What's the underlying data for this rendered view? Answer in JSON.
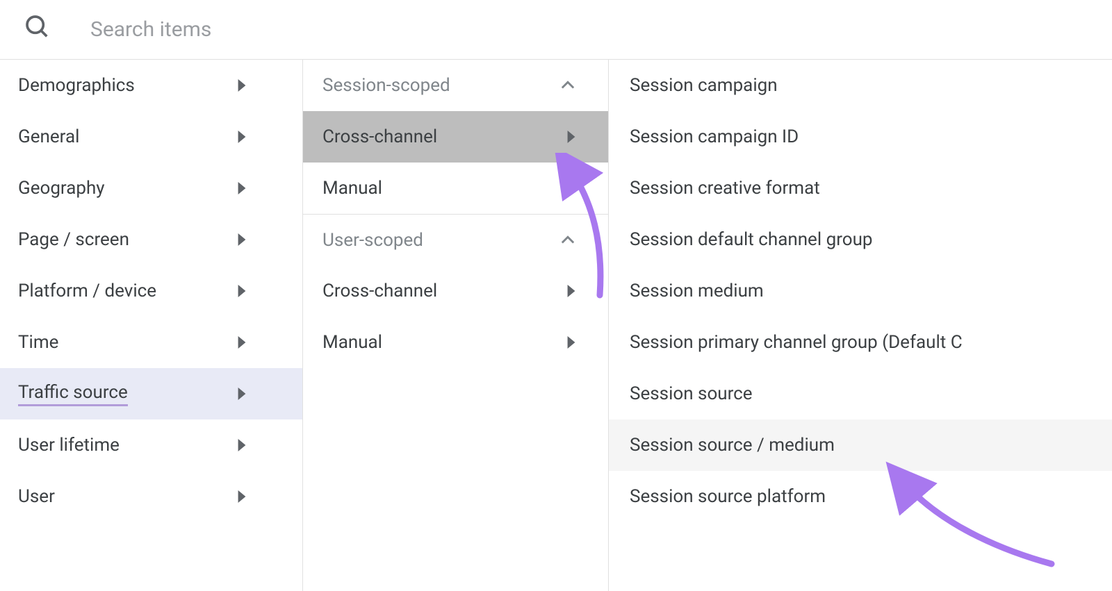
{
  "search": {
    "placeholder": "Search items"
  },
  "col1": {
    "items": [
      {
        "label": "Demographics",
        "name": "menu-demographics"
      },
      {
        "label": "General",
        "name": "menu-general"
      },
      {
        "label": "Geography",
        "name": "menu-geography"
      },
      {
        "label": "Page / screen",
        "name": "menu-page-screen"
      },
      {
        "label": "Platform / device",
        "name": "menu-platform-device"
      },
      {
        "label": "Time",
        "name": "menu-time"
      },
      {
        "label": "Traffic source",
        "name": "menu-traffic-source",
        "selected": true
      },
      {
        "label": "User lifetime",
        "name": "menu-user-lifetime"
      },
      {
        "label": "User",
        "name": "menu-user"
      }
    ]
  },
  "col2": {
    "groups": [
      {
        "header": "Session-scoped",
        "items": [
          {
            "label": "Cross-channel",
            "name": "submenu-session-cross-channel",
            "highlighted": true
          },
          {
            "label": "Manual",
            "name": "submenu-session-manual"
          }
        ]
      },
      {
        "header": "User-scoped",
        "items": [
          {
            "label": "Cross-channel",
            "name": "submenu-user-cross-channel"
          },
          {
            "label": "Manual",
            "name": "submenu-user-manual"
          }
        ]
      }
    ]
  },
  "col3": {
    "items": [
      {
        "label": "Session campaign",
        "name": "dim-session-campaign"
      },
      {
        "label": "Session campaign ID",
        "name": "dim-session-campaign-id"
      },
      {
        "label": "Session creative format",
        "name": "dim-session-creative-format"
      },
      {
        "label": "Session default channel group",
        "name": "dim-session-default-channel-group"
      },
      {
        "label": "Session medium",
        "name": "dim-session-medium"
      },
      {
        "label": "Session primary channel group (Default C",
        "name": "dim-session-primary-channel-group"
      },
      {
        "label": "Session source",
        "name": "dim-session-source"
      },
      {
        "label": "Session source / medium",
        "name": "dim-session-source-medium",
        "hover": true
      },
      {
        "label": "Session source platform",
        "name": "dim-session-source-platform"
      }
    ]
  }
}
